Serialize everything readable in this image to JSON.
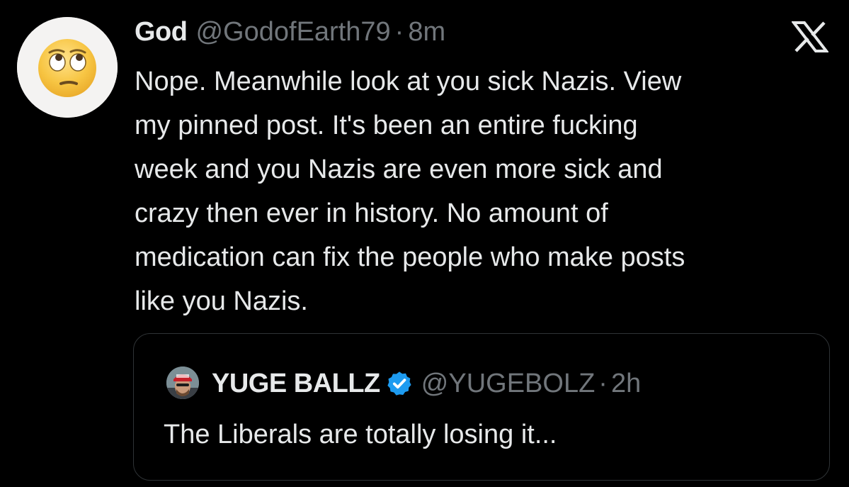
{
  "tweet": {
    "display_name": "God",
    "handle": "@GodofEarth79",
    "separator": "·",
    "time": "8m",
    "avatar_icon": "face-with-rolling-eyes-emoji",
    "text": "Nope. Meanwhile look at you sick Nazis. View\nmy pinned post. It's been an entire fucking\nweek and you Nazis are even more sick and\ncrazy then ever in history. No amount of\nmedication can fix the people who make posts\nlike you Nazis."
  },
  "platform_icon": "x-logo-icon",
  "quoted_tweet": {
    "display_name": "YUGE BALLZ",
    "verified": true,
    "handle": "@YUGEBOLZ",
    "separator": "·",
    "time": "2h",
    "avatar_icon": "profile-photo",
    "text": "The Liberals are totally losing it..."
  },
  "colors": {
    "background": "#000000",
    "primary_text": "#e7e9ea",
    "secondary_text": "#71767b",
    "border": "#2f3336",
    "verified_badge": "#1d9bf0"
  }
}
